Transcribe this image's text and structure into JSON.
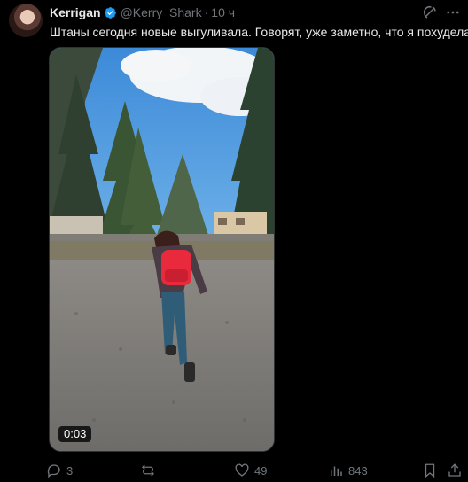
{
  "tweet": {
    "author_name": "Kerrigan",
    "handle": "@Kerry_Shark",
    "dot": "·",
    "time": "10 ч",
    "text": "Штаны сегодня новые выгуливала. Говорят, уже заметно, что я похудела",
    "verified": true
  },
  "media": {
    "type": "video",
    "duration": "0:03"
  },
  "actions": {
    "replies": "3",
    "reposts": "",
    "likes": "49",
    "views": "843"
  },
  "colors": {
    "background": "#000000",
    "text": "#e7e9ea",
    "muted": "#71767b",
    "verified": "#1d9bf0"
  }
}
